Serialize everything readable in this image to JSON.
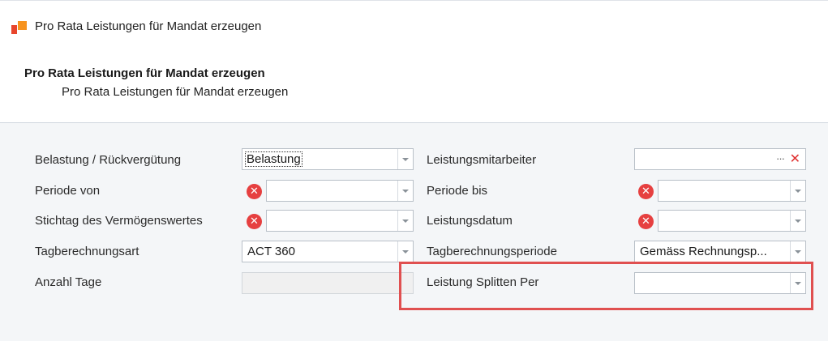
{
  "window": {
    "title": "Pro Rata Leistungen für Mandat erzeugen"
  },
  "header": {
    "title": "Pro Rata Leistungen für Mandat erzeugen",
    "subtitle": "Pro Rata Leistungen für Mandat erzeugen"
  },
  "form": {
    "left": [
      {
        "label": "Belastung / Rückvergütung",
        "value": "Belastung"
      },
      {
        "label": "Periode von",
        "value": ""
      },
      {
        "label": "Stichtag des Vermögenswertes",
        "value": ""
      },
      {
        "label": "Tagberechnungsart",
        "value": "ACT 360"
      },
      {
        "label": "Anzahl Tage",
        "value": ""
      }
    ],
    "right": [
      {
        "label": "Leistungsmitarbeiter",
        "value": ""
      },
      {
        "label": "Periode bis",
        "value": ""
      },
      {
        "label": "Leistungsdatum",
        "value": ""
      },
      {
        "label": "Tagberechnungsperiode",
        "value": "Gemäss Rechnungsp..."
      },
      {
        "label": "Leistung Splitten Per",
        "value": ""
      }
    ],
    "error_icon_glyph": "✕",
    "lookup_glyph": "···",
    "clear_glyph": "✕"
  },
  "colors": {
    "error": "#e64040",
    "highlight": "#e05050",
    "accent_icon_red": "#e8452c",
    "accent_icon_orange": "#f7931e"
  }
}
